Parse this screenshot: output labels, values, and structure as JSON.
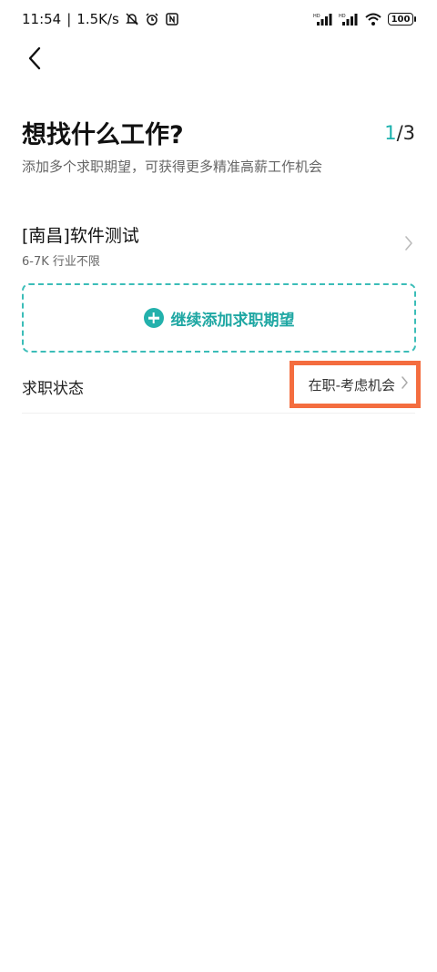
{
  "status_bar": {
    "time": "11:54",
    "speed": "1.5K/s",
    "battery": "100"
  },
  "header": {
    "title": "想找什么工作?",
    "step_current": "1",
    "step_total": "/3",
    "subtitle": "添加多个求职期望，可获得更多精准高薪工作机会"
  },
  "expectation": {
    "title": "[南昌]软件测试",
    "detail": "6-7K 行业不限"
  },
  "add_button": {
    "label": "继续添加求职期望"
  },
  "job_status": {
    "label": "求职状态",
    "value": "在职-考虑机会"
  },
  "colors": {
    "accent": "#1bb1ad",
    "highlight_border": "#f46d3f"
  }
}
